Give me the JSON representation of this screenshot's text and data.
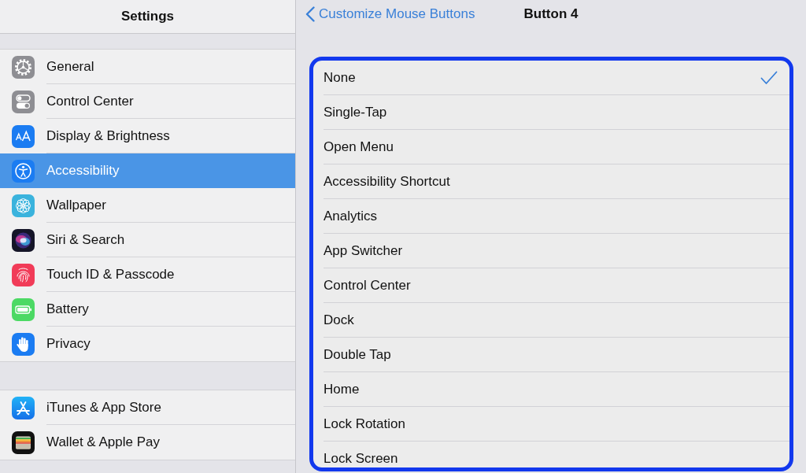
{
  "sidebar": {
    "title": "Settings",
    "groups": [
      {
        "items": [
          {
            "label": "General",
            "selected": false
          },
          {
            "label": "Control Center",
            "selected": false
          },
          {
            "label": "Display & Brightness",
            "selected": false
          },
          {
            "label": "Accessibility",
            "selected": true
          },
          {
            "label": "Wallpaper",
            "selected": false
          },
          {
            "label": "Siri & Search",
            "selected": false
          },
          {
            "label": "Touch ID & Passcode",
            "selected": false
          },
          {
            "label": "Battery",
            "selected": false
          },
          {
            "label": "Privacy",
            "selected": false
          }
        ]
      },
      {
        "items": [
          {
            "label": "iTunes & App Store",
            "selected": false
          },
          {
            "label": "Wallet & Apple Pay",
            "selected": false
          }
        ]
      }
    ]
  },
  "detail": {
    "back": "Customize Mouse Buttons",
    "title": "Button 4",
    "options": {
      "highlighted": true,
      "items": [
        {
          "label": "None",
          "selected": true
        },
        {
          "label": "Single-Tap",
          "selected": false
        },
        {
          "label": "Open Menu",
          "selected": false
        },
        {
          "label": "Accessibility Shortcut",
          "selected": false
        },
        {
          "label": "Analytics",
          "selected": false
        },
        {
          "label": "App Switcher",
          "selected": false
        },
        {
          "label": "Control Center",
          "selected": false
        },
        {
          "label": "Dock",
          "selected": false
        },
        {
          "label": "Double Tap",
          "selected": false
        },
        {
          "label": "Home",
          "selected": false
        },
        {
          "label": "Lock Rotation",
          "selected": false
        },
        {
          "label": "Lock Screen",
          "selected": false
        }
      ]
    }
  }
}
